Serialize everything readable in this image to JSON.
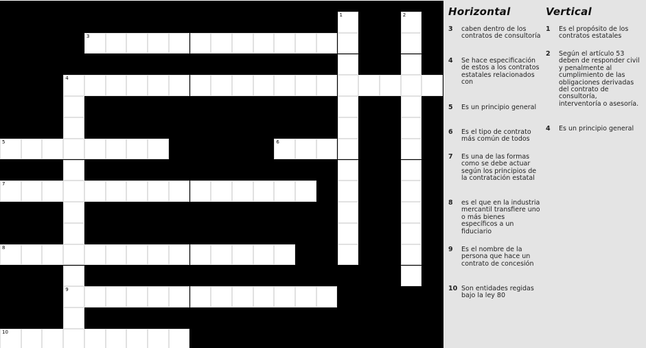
{
  "crossword": {
    "cells": [
      [
        0,
        16
      ],
      [
        0,
        19
      ],
      [
        1,
        4
      ],
      [
        1,
        5
      ],
      [
        1,
        6
      ],
      [
        1,
        7
      ],
      [
        1,
        8
      ],
      [
        1,
        9
      ],
      [
        1,
        10
      ],
      [
        1,
        11
      ],
      [
        1,
        12
      ],
      [
        1,
        13
      ],
      [
        1,
        14
      ],
      [
        1,
        15
      ],
      [
        1,
        16
      ],
      [
        1,
        19
      ],
      [
        2,
        16
      ],
      [
        2,
        19
      ],
      [
        3,
        3
      ],
      [
        3,
        4
      ],
      [
        3,
        5
      ],
      [
        3,
        6
      ],
      [
        3,
        7
      ],
      [
        3,
        8
      ],
      [
        3,
        9
      ],
      [
        3,
        10
      ],
      [
        3,
        11
      ],
      [
        3,
        12
      ],
      [
        3,
        13
      ],
      [
        3,
        14
      ],
      [
        3,
        15
      ],
      [
        3,
        16
      ],
      [
        3,
        17
      ],
      [
        3,
        18
      ],
      [
        3,
        19
      ],
      [
        3,
        20
      ],
      [
        4,
        3
      ],
      [
        4,
        16
      ],
      [
        4,
        19
      ],
      [
        5,
        3
      ],
      [
        5,
        16
      ],
      [
        5,
        19
      ],
      [
        6,
        0
      ],
      [
        6,
        1
      ],
      [
        6,
        2
      ],
      [
        6,
        3
      ],
      [
        6,
        4
      ],
      [
        6,
        5
      ],
      [
        6,
        6
      ],
      [
        6,
        7
      ],
      [
        6,
        13
      ],
      [
        6,
        14
      ],
      [
        6,
        15
      ],
      [
        6,
        16
      ],
      [
        6,
        19
      ],
      [
        7,
        3
      ],
      [
        7,
        16
      ],
      [
        7,
        19
      ],
      [
        8,
        0
      ],
      [
        8,
        1
      ],
      [
        8,
        2
      ],
      [
        8,
        3
      ],
      [
        8,
        4
      ],
      [
        8,
        5
      ],
      [
        8,
        6
      ],
      [
        8,
        7
      ],
      [
        8,
        8
      ],
      [
        8,
        9
      ],
      [
        8,
        10
      ],
      [
        8,
        11
      ],
      [
        8,
        12
      ],
      [
        8,
        13
      ],
      [
        8,
        14
      ],
      [
        8,
        16
      ],
      [
        8,
        19
      ],
      [
        9,
        3
      ],
      [
        9,
        16
      ],
      [
        9,
        19
      ],
      [
        10,
        3
      ],
      [
        10,
        16
      ],
      [
        10,
        19
      ],
      [
        11,
        0
      ],
      [
        11,
        1
      ],
      [
        11,
        2
      ],
      [
        11,
        3
      ],
      [
        11,
        4
      ],
      [
        11,
        5
      ],
      [
        11,
        6
      ],
      [
        11,
        7
      ],
      [
        11,
        8
      ],
      [
        11,
        9
      ],
      [
        11,
        10
      ],
      [
        11,
        11
      ],
      [
        11,
        12
      ],
      [
        11,
        13
      ],
      [
        11,
        16
      ],
      [
        11,
        19
      ],
      [
        12,
        3
      ],
      [
        12,
        19
      ],
      [
        13,
        3
      ],
      [
        13,
        4
      ],
      [
        13,
        5
      ],
      [
        13,
        6
      ],
      [
        13,
        7
      ],
      [
        13,
        8
      ],
      [
        13,
        9
      ],
      [
        13,
        10
      ],
      [
        13,
        11
      ],
      [
        13,
        12
      ],
      [
        13,
        13
      ],
      [
        13,
        14
      ],
      [
        13,
        15
      ],
      [
        14,
        3
      ],
      [
        15,
        0
      ],
      [
        15,
        1
      ],
      [
        15,
        2
      ],
      [
        15,
        3
      ],
      [
        15,
        4
      ],
      [
        15,
        5
      ],
      [
        15,
        6
      ],
      [
        15,
        7
      ],
      [
        15,
        8
      ]
    ],
    "active_cells": [
      [
        6,
        8
      ]
    ],
    "numbers": [
      {
        "row": 0,
        "col": 16,
        "label": "1"
      },
      {
        "row": 0,
        "col": 19,
        "label": "2"
      },
      {
        "row": 1,
        "col": 4,
        "label": "3"
      },
      {
        "row": 3,
        "col": 3,
        "label": "4"
      },
      {
        "row": 6,
        "col": 0,
        "label": "5"
      },
      {
        "row": 6,
        "col": 13,
        "label": "6"
      },
      {
        "row": 8,
        "col": 0,
        "label": "7"
      },
      {
        "row": 11,
        "col": 0,
        "label": "8"
      },
      {
        "row": 13,
        "col": 3,
        "label": "9"
      },
      {
        "row": 15,
        "col": 0,
        "label": "10"
      }
    ]
  },
  "clues": {
    "horizontal_title": "Horizontal",
    "vertical_title": "Vertical",
    "horizontal": [
      {
        "num": "3",
        "text": "caben dentro de los contratos de consultoría"
      },
      {
        "num": "4",
        "text": "Se hace especificación de estos a los contratos estatales relacionados con"
      },
      {
        "num": "5",
        "text": "Es un principio general"
      },
      {
        "num": "6",
        "text": "Es el tipo de contrato más común de todos"
      },
      {
        "num": "7",
        "text": "Es una de las formas como se debe actuar según los principios de la contratación estatal"
      },
      {
        "num": "8",
        "text": "es el que en la industria mercantil transfiere uno o más bienes específicos a un fiduciario"
      },
      {
        "num": "9",
        "text": "Es el nombre de la persona que hace un contrato de concesión"
      },
      {
        "num": "10",
        "text": "Son entidades regidas bajo la ley 80"
      }
    ],
    "vertical": [
      {
        "num": "1",
        "text": "Es el propósito de los contratos estatales"
      },
      {
        "num": "2",
        "text": "Según el artículo 53 deben de responder civil y penalmente al cumplimiento de las obligaciones derivadas del contrato de consultoría, interventoría o asesoría."
      },
      {
        "num": "4",
        "text": "Es un principio general"
      }
    ]
  }
}
